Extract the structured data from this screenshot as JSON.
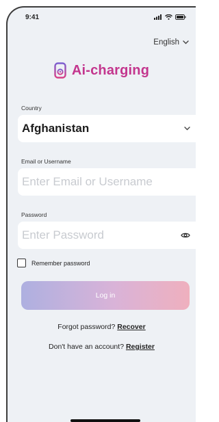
{
  "status_bar": {
    "time": "9:41"
  },
  "language": {
    "label": "English"
  },
  "brand": {
    "name": "Ai-charging"
  },
  "country": {
    "label": "Country",
    "value": "Afghanistan"
  },
  "email": {
    "label": "Email or Username",
    "placeholder": "Enter Email or Username",
    "value": ""
  },
  "password": {
    "label": "Password",
    "placeholder": "Enter Password",
    "value": ""
  },
  "remember": {
    "label": "Remember password",
    "checked": false
  },
  "login": {
    "label": "Log in"
  },
  "forgot": {
    "text": "Forgot password?",
    "link": "Recover"
  },
  "register": {
    "text": "Don't have an account?",
    "link": "Register"
  },
  "colors": {
    "brand": "#c3358d",
    "background": "#eef1f5",
    "button_gradient_start": "#aeb0e0",
    "button_gradient_end": "#efb0be"
  },
  "icons": {
    "brand": "charger-icon",
    "language": "chevron-down-icon",
    "country": "chevron-down-icon",
    "password": "eye-icon",
    "status": [
      "signal-icon",
      "wifi-icon",
      "battery-icon"
    ]
  }
}
